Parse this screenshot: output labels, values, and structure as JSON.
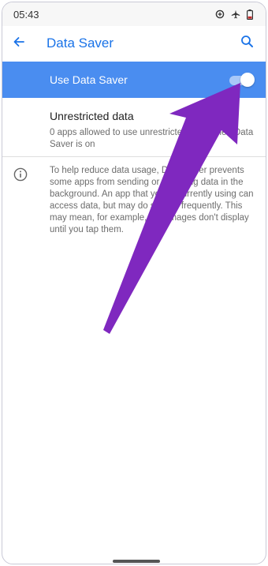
{
  "status_bar": {
    "time": "05:43",
    "icons": [
      "data-saver-icon",
      "airplane-mode-icon",
      "battery-icon"
    ]
  },
  "app_bar": {
    "title": "Data Saver",
    "back_icon": "arrow-back-icon",
    "search_icon": "search-icon"
  },
  "main_toggle": {
    "label": "Use Data Saver",
    "checked": true
  },
  "unrestricted": {
    "title": "Unrestricted data",
    "subtitle": "0 apps allowed to use unrestricted data when Data Saver is on"
  },
  "info": {
    "icon": "info-icon",
    "text": "To help reduce data usage, Data Saver prevents some apps from sending or receiving data in the background. An app that you're currently using can access data, but may do so less frequently. This may mean, for example, that images don't display until you tap them."
  },
  "colors": {
    "accent": "#1a73e8",
    "toggle_row_bg": "#4a8df0",
    "arrow": "#7f28bf"
  }
}
